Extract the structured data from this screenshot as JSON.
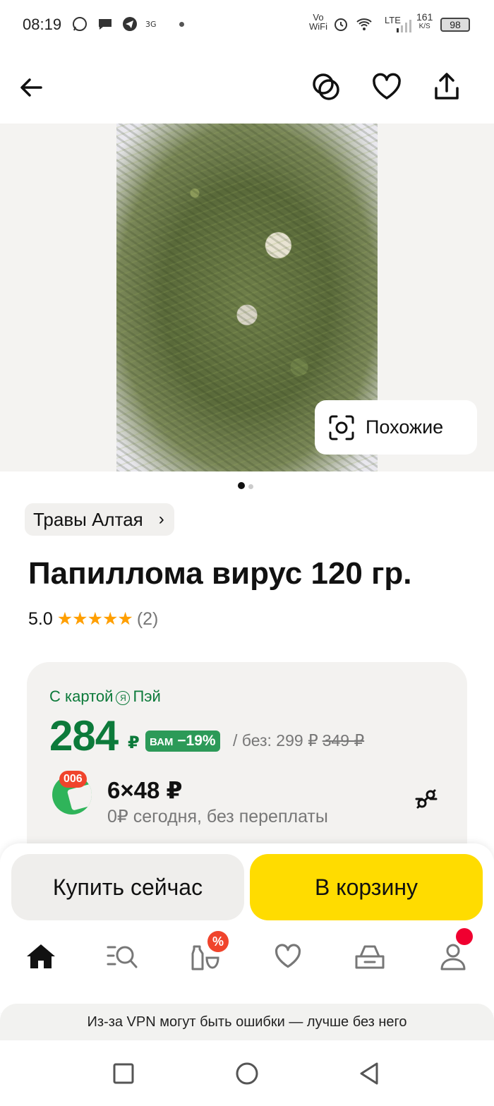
{
  "status_bar": {
    "time": "08:19",
    "vo_wifi_top": "Vo",
    "vo_wifi_bottom": "WiFi",
    "network": "LTE",
    "speed_value": "161",
    "speed_unit": "K/S",
    "battery": "98"
  },
  "header": {
    "back_icon": "arrow-left-icon",
    "compare_icon": "compare-circles-icon",
    "favorite_icon": "heart-icon",
    "share_icon": "share-icon"
  },
  "gallery": {
    "similar_label": "Похожие",
    "page_count": 2,
    "active_page": 1
  },
  "product": {
    "brand": "Травы Алтая",
    "title": "Папиллома вирус 120 гр.",
    "rating": "5.0",
    "stars": "★★★★★",
    "reviews": "(2)"
  },
  "price": {
    "card_label_prefix": "С картой",
    "card_brand_letter": "Я",
    "card_label_suffix": "Пэй",
    "main": "284",
    "currency": "₽",
    "discount_prefix": "вам",
    "discount": "−19%",
    "without_label": "/ без: 299 ₽",
    "old_price": "349 ₽",
    "split_badge": "006",
    "installment": "6×48 ₽",
    "installment_note": "0₽ сегодня, без переплаты"
  },
  "actions": {
    "buy_now": "Купить сейчас",
    "add_to_cart": "В корзину"
  },
  "bottom_nav": {
    "items": [
      "home-icon",
      "catalog-search-icon",
      "promo-icon",
      "favorites-icon",
      "cart-icon",
      "profile-icon"
    ],
    "promo_badge": "%"
  },
  "vpn_banner": "Из-за VPN могут быть ошибки — лучше без него",
  "colors": {
    "accent_yellow": "#ffdc00",
    "price_green": "#0c7a3a",
    "discount_green": "#2c9a58",
    "badge_red": "#f0442c",
    "star_orange": "#ff9f00"
  }
}
